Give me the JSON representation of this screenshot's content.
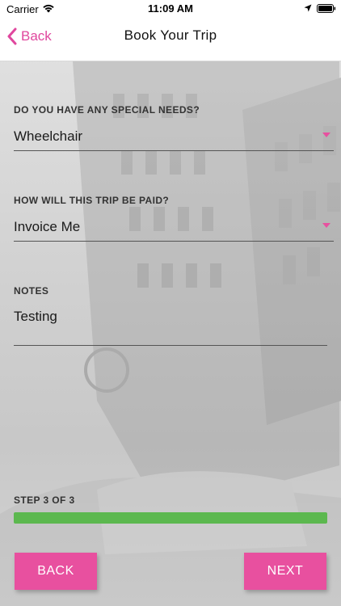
{
  "status_bar": {
    "carrier": "Carrier",
    "time": "11:09 AM"
  },
  "nav": {
    "back_label": "Back",
    "title": "Book Your Trip"
  },
  "form": {
    "special_needs": {
      "label": "DO YOU HAVE ANY SPECIAL NEEDS?",
      "value": "Wheelchair"
    },
    "payment": {
      "label": "HOW WILL THIS TRIP BE PAID?",
      "value": "Invoice Me"
    },
    "notes": {
      "label": "NOTES",
      "value": "Testing"
    }
  },
  "progress": {
    "label": "STEP 3 OF 3",
    "current_step": 3,
    "total_steps": 3,
    "fraction": 1.0
  },
  "buttons": {
    "back": "BACK",
    "next": "NEXT"
  },
  "colors": {
    "accent": "#e8509f",
    "back_link": "#e0479e",
    "progress": "#5cb84f"
  },
  "icons": {
    "wifi": "wifi-icon",
    "location": "location-arrow-icon",
    "battery": "battery-icon",
    "back": "chevron-left-icon",
    "dropdown": "caret-down-icon"
  }
}
